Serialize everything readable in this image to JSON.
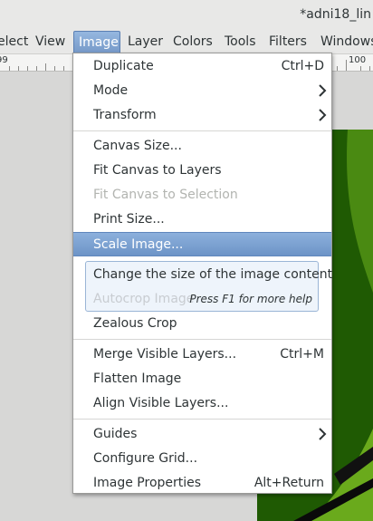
{
  "window": {
    "title": "*adni18_lin"
  },
  "menubar": {
    "items": [
      {
        "label": "elect"
      },
      {
        "label": "View"
      },
      {
        "label": "Image"
      },
      {
        "label": "Layer"
      },
      {
        "label": "Colors"
      },
      {
        "label": "Tools"
      },
      {
        "label": "Filters"
      },
      {
        "label": "Windows"
      }
    ],
    "active": "Image"
  },
  "ruler": {
    "left_label": "99",
    "right_label": "100"
  },
  "image_menu": {
    "items": [
      {
        "label": "Duplicate",
        "accel": "Ctrl+D",
        "enabled": true
      },
      {
        "label": "Mode",
        "submenu": true,
        "enabled": true
      },
      {
        "label": "Transform",
        "submenu": true,
        "enabled": true
      },
      {
        "label": "Canvas Size...",
        "enabled": true
      },
      {
        "label": "Fit Canvas to Layers",
        "enabled": true
      },
      {
        "label": "Fit Canvas to Selection",
        "enabled": false
      },
      {
        "label": "Print Size...",
        "enabled": true
      },
      {
        "label": "Scale Image...",
        "enabled": true,
        "highlighted": true
      },
      {
        "label": "Autocrop Image",
        "enabled": false
      },
      {
        "label": "Zealous Crop",
        "enabled": true
      },
      {
        "label": "Merge Visible Layers...",
        "accel": "Ctrl+M",
        "enabled": true
      },
      {
        "label": "Flatten Image",
        "enabled": true
      },
      {
        "label": "Align Visible Layers...",
        "enabled": true
      },
      {
        "label": "Guides",
        "submenu": true,
        "enabled": true
      },
      {
        "label": "Configure Grid...",
        "enabled": true
      },
      {
        "label": "Image Properties",
        "accel": "Alt+Return",
        "enabled": true
      }
    ]
  },
  "tooltip": {
    "text": "Change the size of the image content",
    "help": "Press F1 for more help"
  },
  "colors": {
    "highlight": "#7699c8",
    "canvas_green": "#1f5a03",
    "canvas_lime": "#5a9a16"
  }
}
